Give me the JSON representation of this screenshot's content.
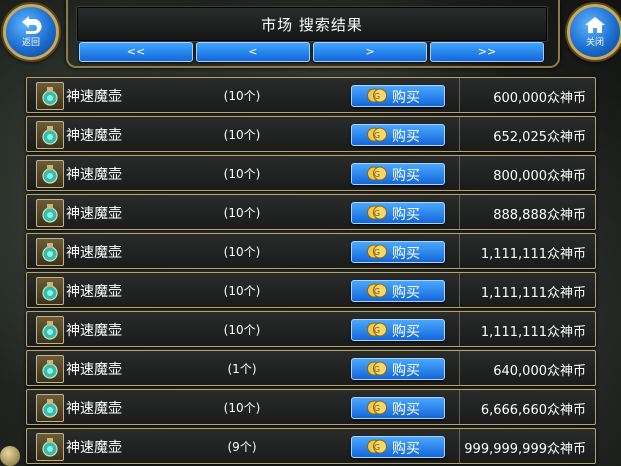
{
  "header": {
    "title": "市场 搜索结果"
  },
  "back_button": {
    "label": "返回"
  },
  "close_button": {
    "label": "关闭"
  },
  "pagination": {
    "first": "<<",
    "prev": "<",
    "next": ">",
    "last": ">>"
  },
  "buy_label": "购买",
  "colors": {
    "button_blue": "#1f7be6",
    "frame_gold": "#b9a36c",
    "row_bg": "#222323"
  },
  "rows": [
    {
      "name": "神速魔壶",
      "qty": "(10个)",
      "price": "600,000众神币"
    },
    {
      "name": "神速魔壶",
      "qty": "(10个)",
      "price": "652,025众神币"
    },
    {
      "name": "神速魔壶",
      "qty": "(10个)",
      "price": "800,000众神币"
    },
    {
      "name": "神速魔壶",
      "qty": "(10个)",
      "price": "888,888众神币"
    },
    {
      "name": "神速魔壶",
      "qty": "(10个)",
      "price": "1,111,111众神币"
    },
    {
      "name": "神速魔壶",
      "qty": "(10个)",
      "price": "1,111,111众神币"
    },
    {
      "name": "神速魔壶",
      "qty": "(10个)",
      "price": "1,111,111众神币"
    },
    {
      "name": "神速魔壶",
      "qty": "(1个)",
      "price": "640,000众神币"
    },
    {
      "name": "神速魔壶",
      "qty": "(10个)",
      "price": "6,666,660众神币"
    },
    {
      "name": "神速魔壶",
      "qty": "(9个)",
      "price": "999,999,999众神币"
    }
  ]
}
